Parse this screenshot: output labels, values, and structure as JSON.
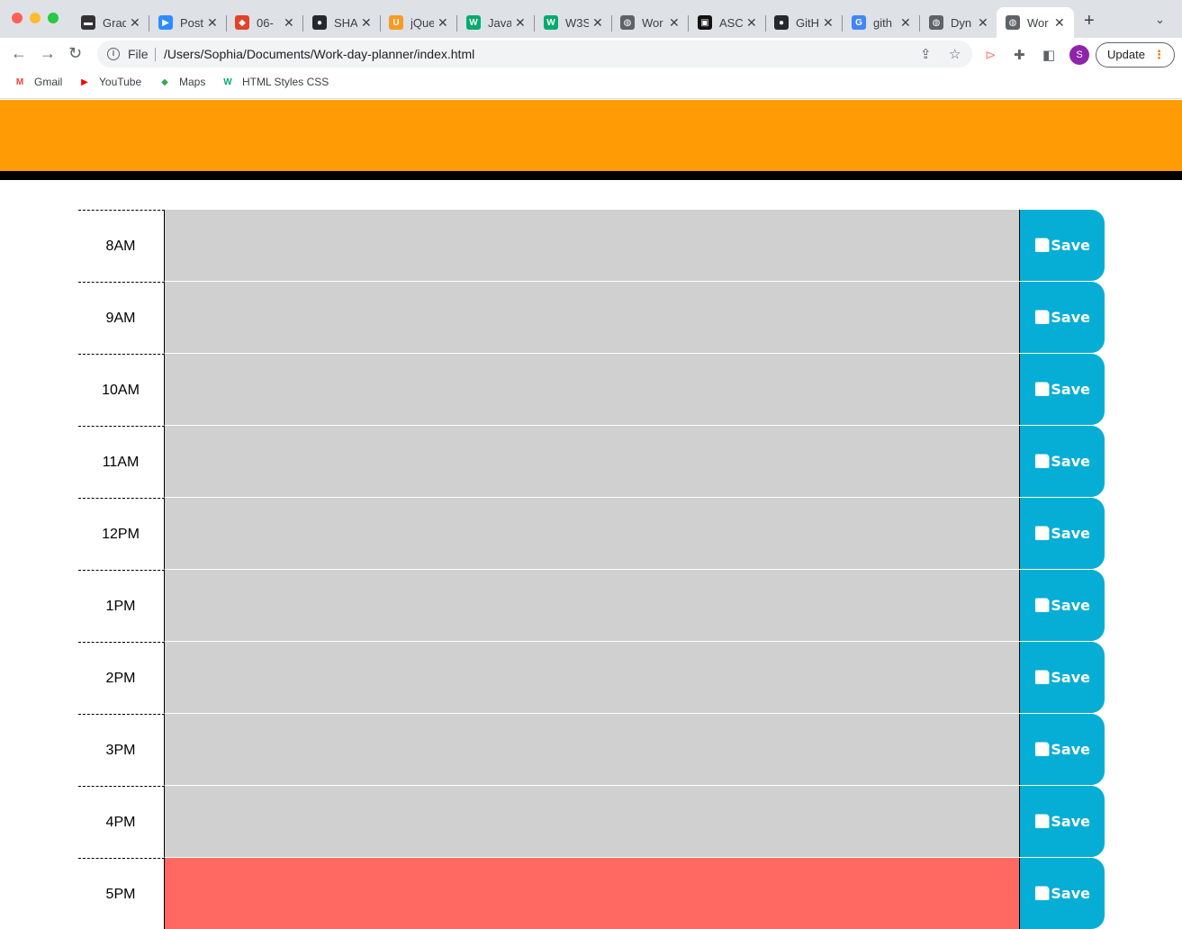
{
  "browser": {
    "tabs": [
      {
        "label": "Grad",
        "icon": "grades-favicon-icon",
        "color": "#333333",
        "glyph": "▬"
      },
      {
        "label": "Post",
        "icon": "zoom-icon",
        "color": "#2d8cff",
        "glyph": "▶"
      },
      {
        "label": "06-",
        "icon": "gitlab-icon",
        "color": "#e24329",
        "glyph": "◆"
      },
      {
        "label": "SHA",
        "icon": "github-icon",
        "color": "#24292e",
        "glyph": "●"
      },
      {
        "label": "jQue",
        "icon": "udemy-icon",
        "color": "#f69b23",
        "glyph": "U"
      },
      {
        "label": "Java",
        "icon": "w3schools-icon",
        "color": "#04aa6d",
        "glyph": "W"
      },
      {
        "label": "W3S",
        "icon": "w3schools-icon",
        "color": "#04aa6d",
        "glyph": "W"
      },
      {
        "label": "Wor",
        "icon": "globe-icon",
        "color": "#5f6368",
        "glyph": "◍"
      },
      {
        "label": "ASC",
        "icon": "ascii-favicon-icon",
        "color": "#111111",
        "glyph": "▣"
      },
      {
        "label": "GitH",
        "icon": "github-icon",
        "color": "#24292e",
        "glyph": "●"
      },
      {
        "label": "gith",
        "icon": "google-icon",
        "color": "#4285f4",
        "glyph": "G"
      },
      {
        "label": "Dyn",
        "icon": "globe-icon",
        "color": "#5f6368",
        "glyph": "◍"
      },
      {
        "label": "Wor",
        "icon": "globe-icon",
        "color": "#5f6368",
        "glyph": "◍",
        "active": true
      }
    ],
    "file_label": "File",
    "url": "/Users/Sophia/Documents/Work-day-planner/index.html",
    "avatar_letter": "S",
    "update_label": "Update",
    "bookmarks": [
      {
        "label": "Gmail",
        "icon": "gmail-icon",
        "color": "#ea4335",
        "glyph": "M"
      },
      {
        "label": "YouTube",
        "icon": "youtube-icon",
        "color": "#ff0000",
        "glyph": "▶"
      },
      {
        "label": "Maps",
        "icon": "maps-icon",
        "color": "#34a853",
        "glyph": "◆"
      },
      {
        "label": "HTML Styles CSS",
        "icon": "w3schools-icon",
        "color": "#04aa6d",
        "glyph": "W"
      }
    ]
  },
  "planner": {
    "save_label": "Save",
    "colors": {
      "header": "#ff9b05",
      "past": "#d0d0d0",
      "present": "#ff6961",
      "save": "#06aed5"
    },
    "hours": [
      {
        "label": "8AM",
        "status": "past",
        "text": ""
      },
      {
        "label": "9AM",
        "status": "past",
        "text": ""
      },
      {
        "label": "10AM",
        "status": "past",
        "text": ""
      },
      {
        "label": "11AM",
        "status": "past",
        "text": ""
      },
      {
        "label": "12PM",
        "status": "past",
        "text": ""
      },
      {
        "label": "1PM",
        "status": "past",
        "text": ""
      },
      {
        "label": "2PM",
        "status": "past",
        "text": ""
      },
      {
        "label": "3PM",
        "status": "past",
        "text": ""
      },
      {
        "label": "4PM",
        "status": "past",
        "text": ""
      },
      {
        "label": "5PM",
        "status": "present",
        "text": ""
      }
    ]
  }
}
